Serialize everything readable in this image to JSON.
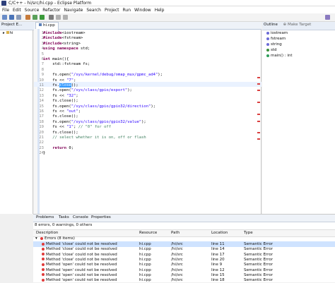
{
  "window": {
    "title": "C/C++ - hi/src/hi.cpp - Eclipse Platform"
  },
  "menu": [
    "File",
    "Edit",
    "Source",
    "Refactor",
    "Navigate",
    "Search",
    "Project",
    "Run",
    "Window",
    "Help"
  ],
  "project_explorer": {
    "tab_label": "Project E...",
    "tree_item": "hi"
  },
  "editor": {
    "tab_label": "hi.cpp",
    "lines": [
      {
        "n": "1",
        "segs": [
          {
            "t": "#include",
            "c": "kw"
          },
          {
            "t": "<iostream>"
          }
        ]
      },
      {
        "n": "2",
        "segs": [
          {
            "t": "#include",
            "c": "kw"
          },
          {
            "t": "<fstream>"
          }
        ]
      },
      {
        "n": "3",
        "segs": [
          {
            "t": "#include",
            "c": "kw"
          },
          {
            "t": "<string>"
          }
        ]
      },
      {
        "n": "4",
        "segs": [
          {
            "t": "using namespace",
            "c": "kw"
          },
          {
            "t": " std;"
          }
        ]
      },
      {
        "n": "5",
        "segs": []
      },
      {
        "n": "6",
        "segs": [
          {
            "t": "int",
            "c": "kw"
          },
          {
            "t": " main(){"
          }
        ]
      },
      {
        "n": "7",
        "segs": [
          {
            "t": "    std::fstream fs;"
          }
        ]
      },
      {
        "n": "8",
        "segs": []
      },
      {
        "n": "9",
        "segs": [
          {
            "t": "    fs.open("
          },
          {
            "t": "\"/sys/kernel/debug/omap_mux/gpmc_ad4\"",
            "c": "str"
          },
          {
            "t": ");"
          }
        ]
      },
      {
        "n": "10",
        "segs": [
          {
            "t": "    fs << "
          },
          {
            "t": "\"7\"",
            "c": "str"
          },
          {
            "t": ";"
          }
        ]
      },
      {
        "n": "11",
        "segs": [
          {
            "t": "    fs."
          },
          {
            "t": "close",
            "c": "sel"
          },
          {
            "t": "();"
          }
        ]
      },
      {
        "n": "12",
        "segs": [
          {
            "t": "    fs.open("
          },
          {
            "t": "\"/sys/class/gpio/export\"",
            "c": "str"
          },
          {
            "t": ");"
          }
        ]
      },
      {
        "n": "13",
        "segs": [
          {
            "t": "    fs << "
          },
          {
            "t": "\"32\"",
            "c": "str"
          },
          {
            "t": ";"
          }
        ]
      },
      {
        "n": "14",
        "segs": [
          {
            "t": "    fs.close();"
          }
        ]
      },
      {
        "n": "15",
        "segs": [
          {
            "t": "    fs.open("
          },
          {
            "t": "\"/sys/class/gpio/gpio32/direction\"",
            "c": "str"
          },
          {
            "t": ");"
          }
        ]
      },
      {
        "n": "16",
        "segs": [
          {
            "t": "    fs << "
          },
          {
            "t": "\"out\"",
            "c": "str"
          },
          {
            "t": ";"
          }
        ]
      },
      {
        "n": "17",
        "segs": [
          {
            "t": "    fs.close();"
          }
        ]
      },
      {
        "n": "18",
        "segs": [
          {
            "t": "    fs.open("
          },
          {
            "t": "\"/sys/class/gpio/gpio32/value\"",
            "c": "str"
          },
          {
            "t": ");"
          }
        ]
      },
      {
        "n": "19",
        "segs": [
          {
            "t": "    fs << "
          },
          {
            "t": "\"1\"",
            "c": "str"
          },
          {
            "t": "; "
          },
          {
            "t": "// \"0\" for off",
            "c": "cmt"
          }
        ]
      },
      {
        "n": "20",
        "segs": [
          {
            "t": "    fs.close();"
          }
        ]
      },
      {
        "n": "21",
        "segs": [
          {
            "t": "    "
          },
          {
            "t": "// select whether it is on, off or flash",
            "c": "cmt"
          }
        ]
      },
      {
        "n": "22",
        "segs": []
      },
      {
        "n": "23",
        "segs": [
          {
            "t": "    "
          },
          {
            "t": "return",
            "c": "kw"
          },
          {
            "t": " 0;"
          }
        ]
      },
      {
        "n": "24",
        "segs": [
          {
            "t": "}"
          }
        ]
      }
    ]
  },
  "outline": {
    "tab_label": "Outline",
    "tab2_label": "Make Target",
    "items": [
      {
        "label": "iostream",
        "icon": "include-icon"
      },
      {
        "label": "fstream",
        "icon": "include-icon"
      },
      {
        "label": "string",
        "icon": "include-icon"
      },
      {
        "label": "std",
        "icon": "namespace-icon"
      },
      {
        "label": "main() : int",
        "icon": "function-icon"
      }
    ]
  },
  "problems": {
    "tabs": [
      "Problems",
      "Tasks",
      "Console",
      "Properties"
    ],
    "summary": "8 errors, 0 warnings, 0 others",
    "columns": [
      "Description",
      "Resource",
      "Path",
      "Location",
      "Type"
    ],
    "group": "Errors (8 items)",
    "rows": [
      {
        "desc": "Method 'close' could not be resolved",
        "res": "hi.cpp",
        "path": "/hi/src",
        "loc": "line 11",
        "type": "Semantic Error"
      },
      {
        "desc": "Method 'close' could not be resolved",
        "res": "hi.cpp",
        "path": "/hi/src",
        "loc": "line 14",
        "type": "Semantic Error"
      },
      {
        "desc": "Method 'close' could not be resolved",
        "res": "hi.cpp",
        "path": "/hi/src",
        "loc": "line 17",
        "type": "Semantic Error"
      },
      {
        "desc": "Method 'close' could not be resolved",
        "res": "hi.cpp",
        "path": "/hi/src",
        "loc": "line 20",
        "type": "Semantic Error"
      },
      {
        "desc": "Method 'open' could not be resolved",
        "res": "hi.cpp",
        "path": "/hi/src",
        "loc": "line 9",
        "type": "Semantic Error"
      },
      {
        "desc": "Method 'open' could not be resolved",
        "res": "hi.cpp",
        "path": "/hi/src",
        "loc": "line 12",
        "type": "Semantic Error"
      },
      {
        "desc": "Method 'open' could not be resolved",
        "res": "hi.cpp",
        "path": "/hi/src",
        "loc": "line 15",
        "type": "Semantic Error"
      },
      {
        "desc": "Method 'open' could not be resolved",
        "res": "hi.cpp",
        "path": "/hi/src",
        "loc": "line 18",
        "type": "Semantic Error"
      }
    ]
  },
  "colors": {
    "keyword": "#7f0055",
    "string": "#2a00ff",
    "comment": "#3f7f5f",
    "selection": "#3399ff",
    "error": "#e03a3a"
  }
}
